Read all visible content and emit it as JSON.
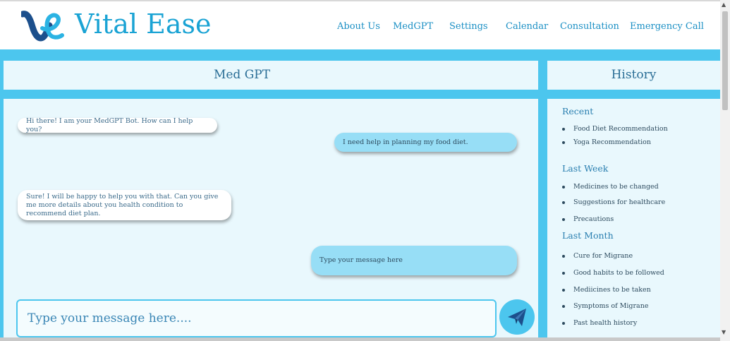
{
  "brand": {
    "name": "Vital Ease",
    "logo_icon": "ve-logo-icon"
  },
  "nav": [
    {
      "label": "About Us"
    },
    {
      "label": "MedGPT"
    },
    {
      "label": "Settings"
    },
    {
      "label": "Calendar"
    },
    {
      "label": "Consultation"
    },
    {
      "label": "Emergency Call"
    }
  ],
  "chat": {
    "title": "Med GPT",
    "messages": [
      {
        "from": "bot",
        "text": "Hi there! I am your MedGPT Bot. How can I help you?"
      },
      {
        "from": "user",
        "text": "I need help in planning my food diet."
      },
      {
        "from": "bot",
        "text": "Sure! I will be happy to help you with that. Can you give me more details about you health condition to recommend diet plan."
      },
      {
        "from": "user",
        "text": "Type your message here"
      }
    ],
    "input_placeholder": "Type your message here....",
    "send_icon": "paper-plane-icon"
  },
  "history": {
    "title": "History",
    "groups": [
      {
        "heading": "Recent",
        "items": [
          "Food Diet Recommendation",
          "Yoga Recommendation"
        ]
      },
      {
        "heading": "Last Week",
        "items": [
          "Medicines to be changed",
          "Suggestions for healthcare",
          "Precautions"
        ]
      },
      {
        "heading": "Last Month",
        "items": [
          "Cure for Migrane",
          "Good habits to be followed",
          "Mediicines to be taken",
          "Symptoms of Migrane",
          "Past health history"
        ]
      }
    ]
  },
  "colors": {
    "accent": "#4cc6ee",
    "panel": "#e9f8fd",
    "user_bubble": "#97def6",
    "brand_text": "#1aa3d4"
  }
}
